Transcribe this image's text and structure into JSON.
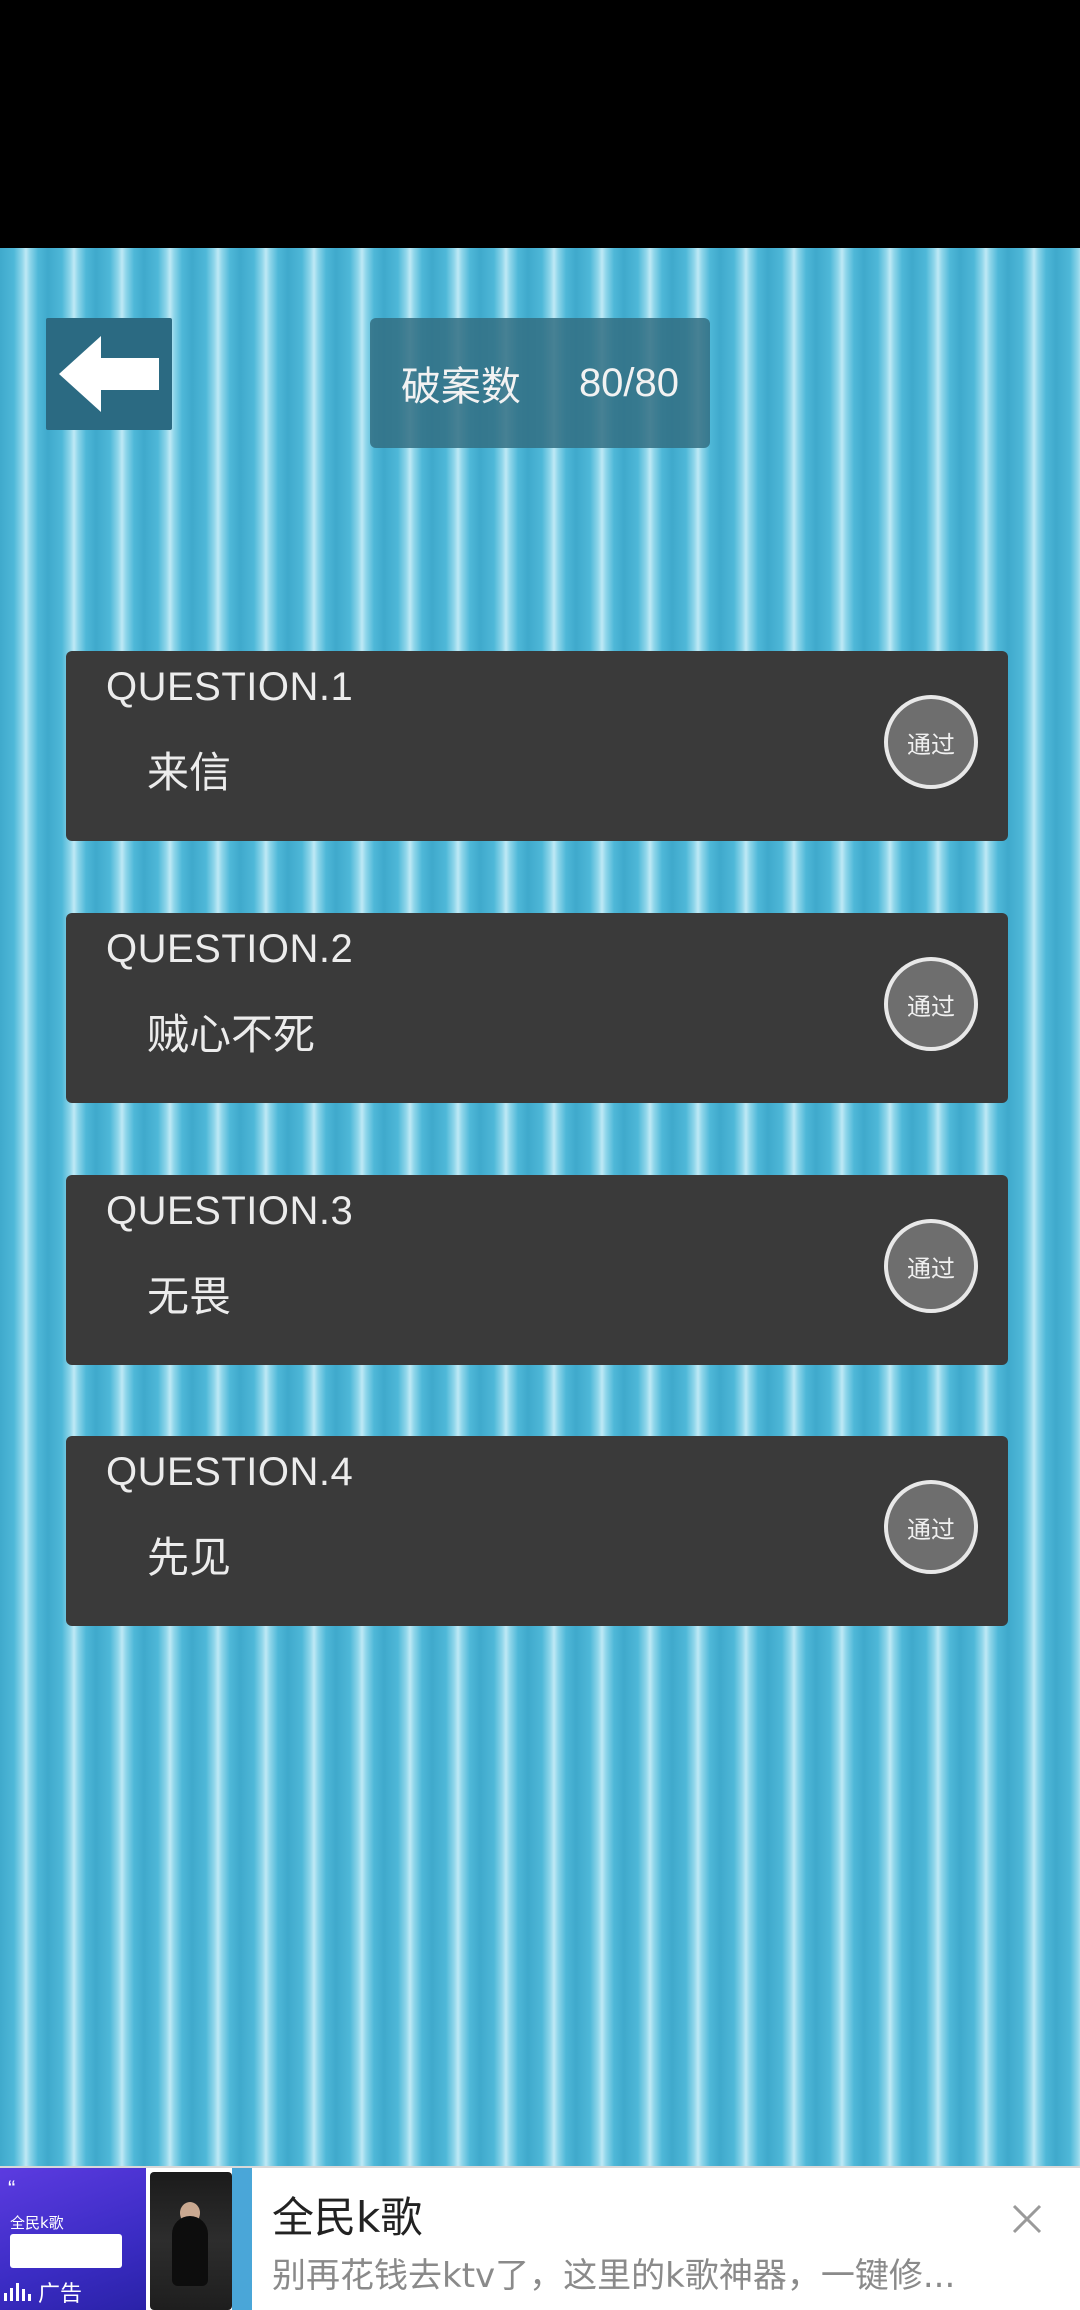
{
  "header": {
    "score_label": "破案数",
    "score_value": "80/80"
  },
  "questions": [
    {
      "title": "QUESTION.1",
      "name": "来信",
      "status": "通过"
    },
    {
      "title": "QUESTION.2",
      "name": "贼心不死",
      "status": "通过"
    },
    {
      "title": "QUESTION.3",
      "name": "无畏",
      "status": "通过"
    },
    {
      "title": "QUESTION.4",
      "name": "先见",
      "status": "通过"
    }
  ],
  "ad": {
    "title": "全民k歌",
    "description": "别再花钱去ktv了，这里的k歌神器，一键修...",
    "tag": "广告",
    "thumb_text": "全民k歌"
  },
  "colors": {
    "background": "#4ab4d4",
    "card": "#3a3a3a",
    "back_button": "#2b6a82"
  }
}
